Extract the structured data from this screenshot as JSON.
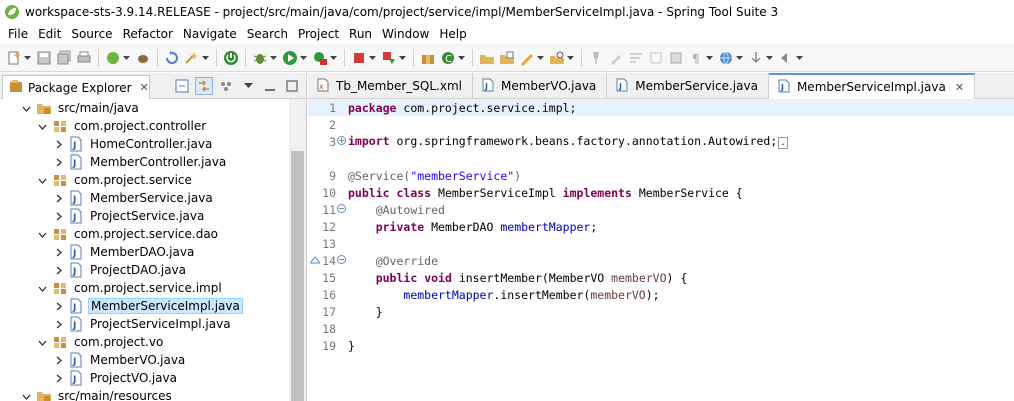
{
  "window": {
    "title": "workspace-sts-3.9.14.RELEASE - project/src/main/java/com/project/service/impl/MemberServiceImpl.java - Spring Tool Suite 3",
    "app_icon": "spring-leaf-icon"
  },
  "menu": [
    "File",
    "Edit",
    "Source",
    "Refactor",
    "Navigate",
    "Search",
    "Project",
    "Run",
    "Window",
    "Help"
  ],
  "explorer": {
    "tab_label": "Package Explorer",
    "tree": [
      {
        "label": "src/main/java",
        "icon": "source-folder-icon",
        "expanded": true
      },
      {
        "label": "com.project.controller",
        "icon": "package-icon",
        "expanded": true
      },
      {
        "label": "HomeController.java",
        "icon": "java-file-icon",
        "expanded": false
      },
      {
        "label": "MemberController.java",
        "icon": "java-file-icon",
        "expanded": false
      },
      {
        "label": "com.project.service",
        "icon": "package-icon",
        "expanded": true
      },
      {
        "label": "MemberService.java",
        "icon": "java-file-icon",
        "expanded": false
      },
      {
        "label": "ProjectService.java",
        "icon": "java-file-icon",
        "expanded": false
      },
      {
        "label": "com.project.service.dao",
        "icon": "package-icon",
        "expanded": true
      },
      {
        "label": "MemberDAO.java",
        "icon": "java-file-icon",
        "expanded": false
      },
      {
        "label": "ProjectDAO.java",
        "icon": "java-file-icon",
        "expanded": false
      },
      {
        "label": "com.project.service.impl",
        "icon": "package-icon",
        "expanded": true
      },
      {
        "label": "MemberServiceImpl.java",
        "icon": "java-file-icon",
        "expanded": false,
        "selected": true
      },
      {
        "label": "ProjectServiceImpl.java",
        "icon": "java-file-icon",
        "expanded": false
      },
      {
        "label": "com.project.vo",
        "icon": "package-icon",
        "expanded": true
      },
      {
        "label": "MemberVO.java",
        "icon": "java-file-icon",
        "expanded": false
      },
      {
        "label": "ProjectVO.java",
        "icon": "java-file-icon",
        "expanded": false
      },
      {
        "label": "src/main/resources",
        "icon": "source-folder-icon",
        "expanded": true
      }
    ]
  },
  "editor": {
    "tabs": [
      {
        "label": "Tb_Member_SQL.xml",
        "icon": "xml-file-icon",
        "active": false
      },
      {
        "label": "MemberVO.java",
        "icon": "java-file-icon",
        "active": false
      },
      {
        "label": "MemberService.java",
        "icon": "java-file-icon",
        "active": false
      },
      {
        "label": "MemberServiceImpl.java",
        "icon": "java-file-icon",
        "active": true
      }
    ],
    "lines": [
      {
        "n": "1",
        "text": "package com.project.service.impl;"
      },
      {
        "n": "2",
        "text": ""
      },
      {
        "n": "3",
        "text": "import org.springframework.beans.factory.annotation.Autowired;"
      },
      {
        "n": "9",
        "text": "@Service(\"memberService\")"
      },
      {
        "n": "10",
        "text": "public class MemberServiceImpl implements MemberService {"
      },
      {
        "n": "11",
        "text": "    @Autowired"
      },
      {
        "n": "12",
        "text": "    private MemberDAO membertMapper;"
      },
      {
        "n": "13",
        "text": ""
      },
      {
        "n": "14",
        "text": "    @Override"
      },
      {
        "n": "15",
        "text": "    public void insertMember(MemberVO memberVO) {"
      },
      {
        "n": "16",
        "text": "        membertMapper.insertMember(memberVO);"
      },
      {
        "n": "17",
        "text": "    }"
      },
      {
        "n": "18",
        "text": ""
      },
      {
        "n": "19",
        "text": "}"
      }
    ]
  },
  "colors": {
    "keyword": "#7f0055",
    "string": "#2a00ff",
    "annotation": "#646464",
    "field": "#0000c0",
    "parameter": "#6a3e3e",
    "selection": "#cce8ff",
    "current_line": "#e8f2fe"
  }
}
